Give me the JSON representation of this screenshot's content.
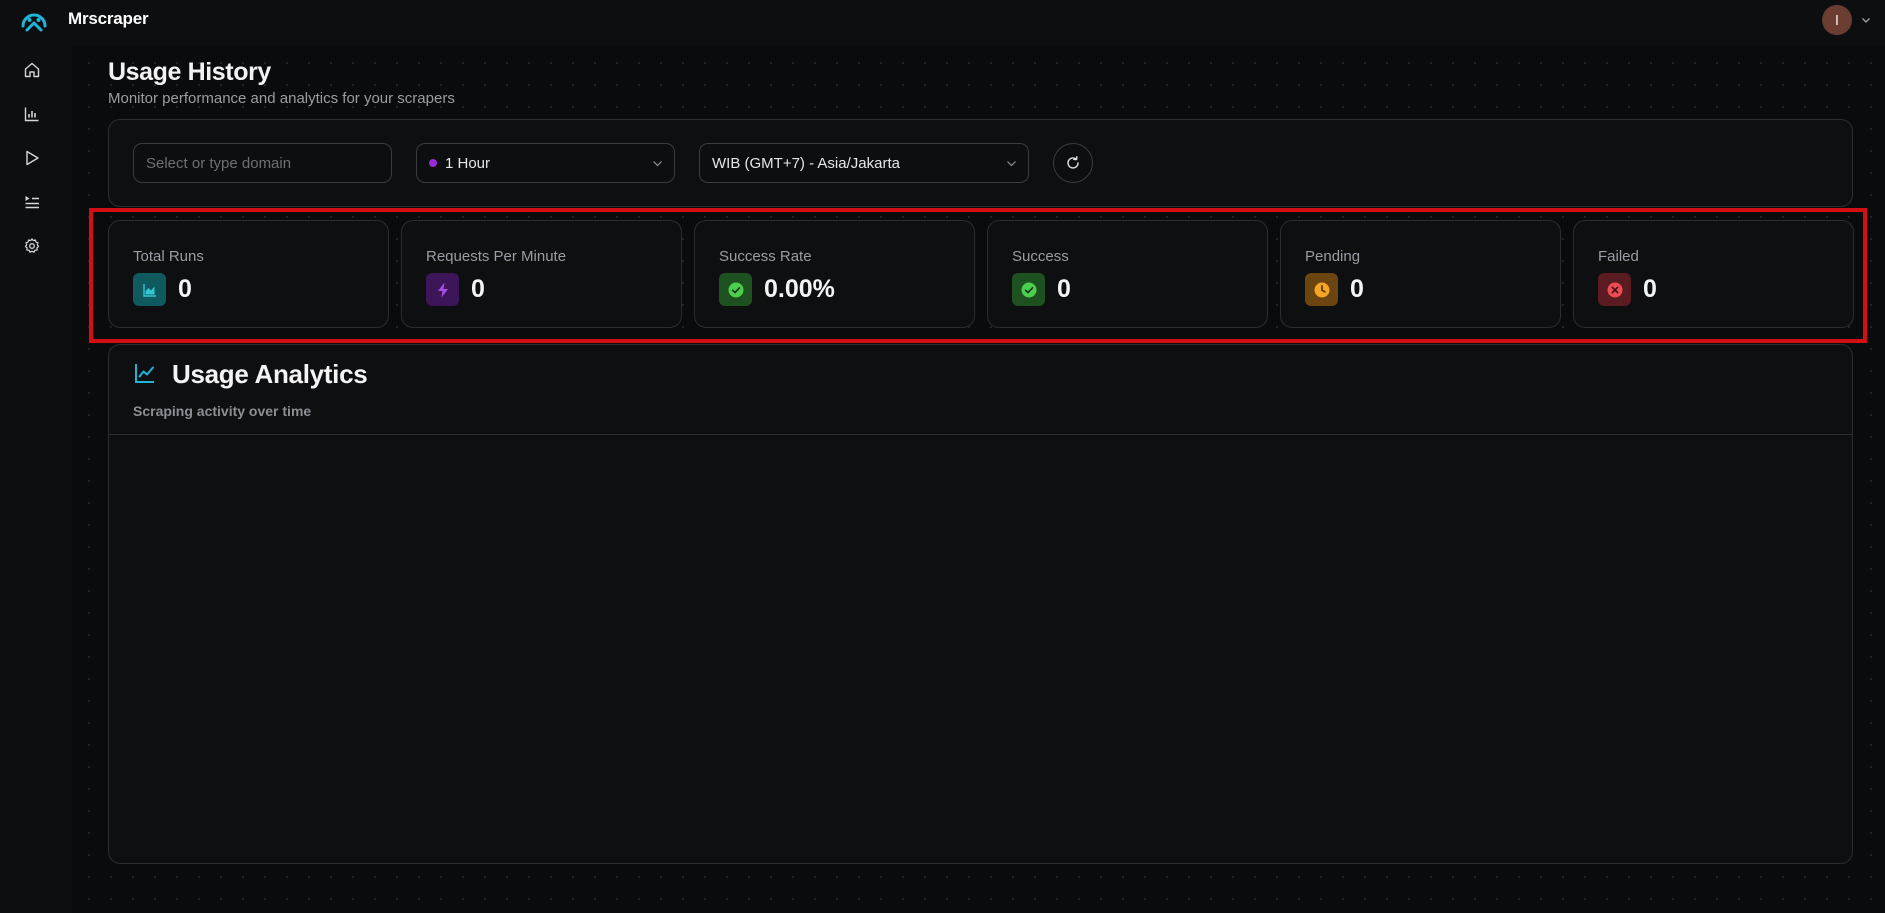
{
  "app": {
    "brand": "Mrscraper",
    "user_initial": "I",
    "accent_color": "#1fb5d6"
  },
  "sidebar": {
    "items": [
      {
        "name": "home",
        "icon": "home-icon"
      },
      {
        "name": "usage",
        "icon": "bar-chart-icon"
      },
      {
        "name": "runs",
        "icon": "play-icon"
      },
      {
        "name": "queue",
        "icon": "list-play-icon"
      },
      {
        "name": "settings",
        "icon": "gear-icon"
      }
    ]
  },
  "page": {
    "title": "Usage History",
    "subtitle": "Monitor performance and analytics for your scrapers"
  },
  "filters": {
    "domain_placeholder": "Select or type domain",
    "domain_value": "",
    "time_range": "1 Hour",
    "time_range_dot_color": "#9b2bd9",
    "timezone": "WIB (GMT+7) - Asia/Jakarta"
  },
  "stats": [
    {
      "label": "Total Runs",
      "value": "0",
      "icon": "area-chart-icon",
      "icon_bg": "#0f5a5e",
      "icon_color": "#36c6d3"
    },
    {
      "label": "Requests Per Minute",
      "value": "0",
      "icon": "lightning-icon",
      "icon_bg": "#3d1659",
      "icon_color": "#a64ee6"
    },
    {
      "label": "Success Rate",
      "value": "0.00%",
      "icon": "check-circle-icon",
      "icon_bg": "#1e5120",
      "icon_color": "#4ccf4f"
    },
    {
      "label": "Success",
      "value": "0",
      "icon": "check-circle-icon",
      "icon_bg": "#1e5120",
      "icon_color": "#4ccf4f"
    },
    {
      "label": "Pending",
      "value": "0",
      "icon": "clock-icon",
      "icon_bg": "#6b4410",
      "icon_color": "#f4a623"
    },
    {
      "label": "Failed",
      "value": "0",
      "icon": "x-circle-icon",
      "icon_bg": "#5a1c20",
      "icon_color": "#ef4c55"
    }
  ],
  "analytics": {
    "title": "Usage Analytics",
    "subtitle": "Scraping activity over time"
  }
}
